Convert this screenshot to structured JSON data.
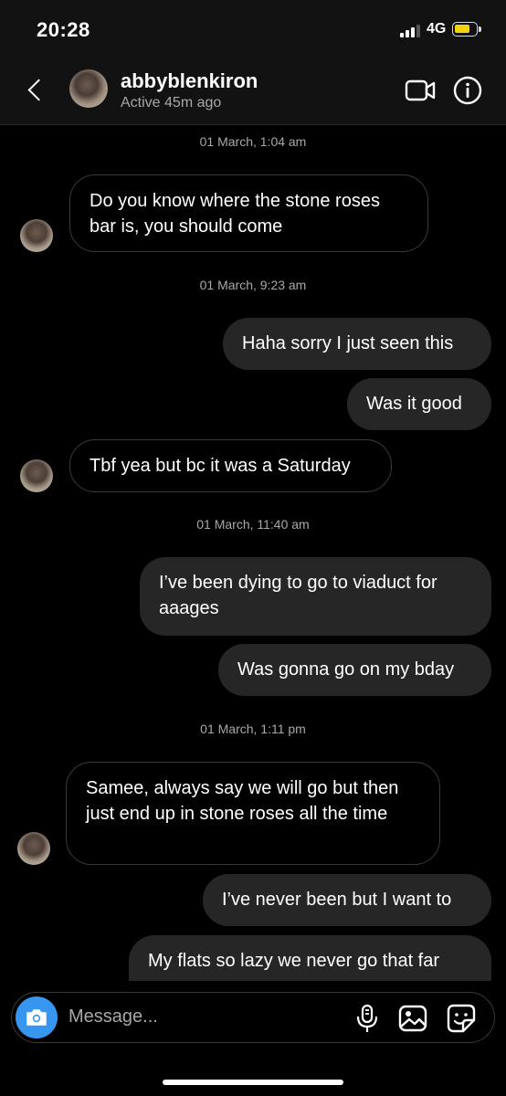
{
  "status_bar": {
    "time": "20:28",
    "network": "4G"
  },
  "header": {
    "username": "abbyblenkiron",
    "active_status": "Active 45m ago"
  },
  "messages": [
    {
      "type": "timestamp",
      "text": "01 March, 1:04 am"
    },
    {
      "type": "received",
      "text": "Do you know where the stone roses bar is, you should come"
    },
    {
      "type": "timestamp",
      "text": "01 March, 9:23 am"
    },
    {
      "type": "sent",
      "text": "Haha sorry I just seen this"
    },
    {
      "type": "sent",
      "text": "Was it good"
    },
    {
      "type": "received",
      "text": "Tbf yea but bc it was a Saturday"
    },
    {
      "type": "timestamp",
      "text": "01 March, 11:40 am"
    },
    {
      "type": "sent",
      "text": "I’ve been dying to go to viaduct for aaages"
    },
    {
      "type": "sent",
      "text": "Was gonna go on my bday"
    },
    {
      "type": "timestamp",
      "text": "01 March, 1:11 pm"
    },
    {
      "type": "received",
      "text": "Samee, always say we will go but then just end up in stone roses all the time"
    },
    {
      "type": "sent",
      "text": "I’ve never been but I want to"
    },
    {
      "type": "sent",
      "text": "My flats so lazy we never go that far"
    }
  ],
  "composer": {
    "placeholder": "Message..."
  },
  "colors": {
    "background": "#000000",
    "sent_bubble": "#262626",
    "camera_button": "#3797f0",
    "battery": "#f5d110"
  },
  "icons": [
    "back-chevron-icon",
    "video-call-icon",
    "info-icon",
    "camera-icon",
    "microphone-icon",
    "gallery-icon",
    "sticker-icon"
  ]
}
